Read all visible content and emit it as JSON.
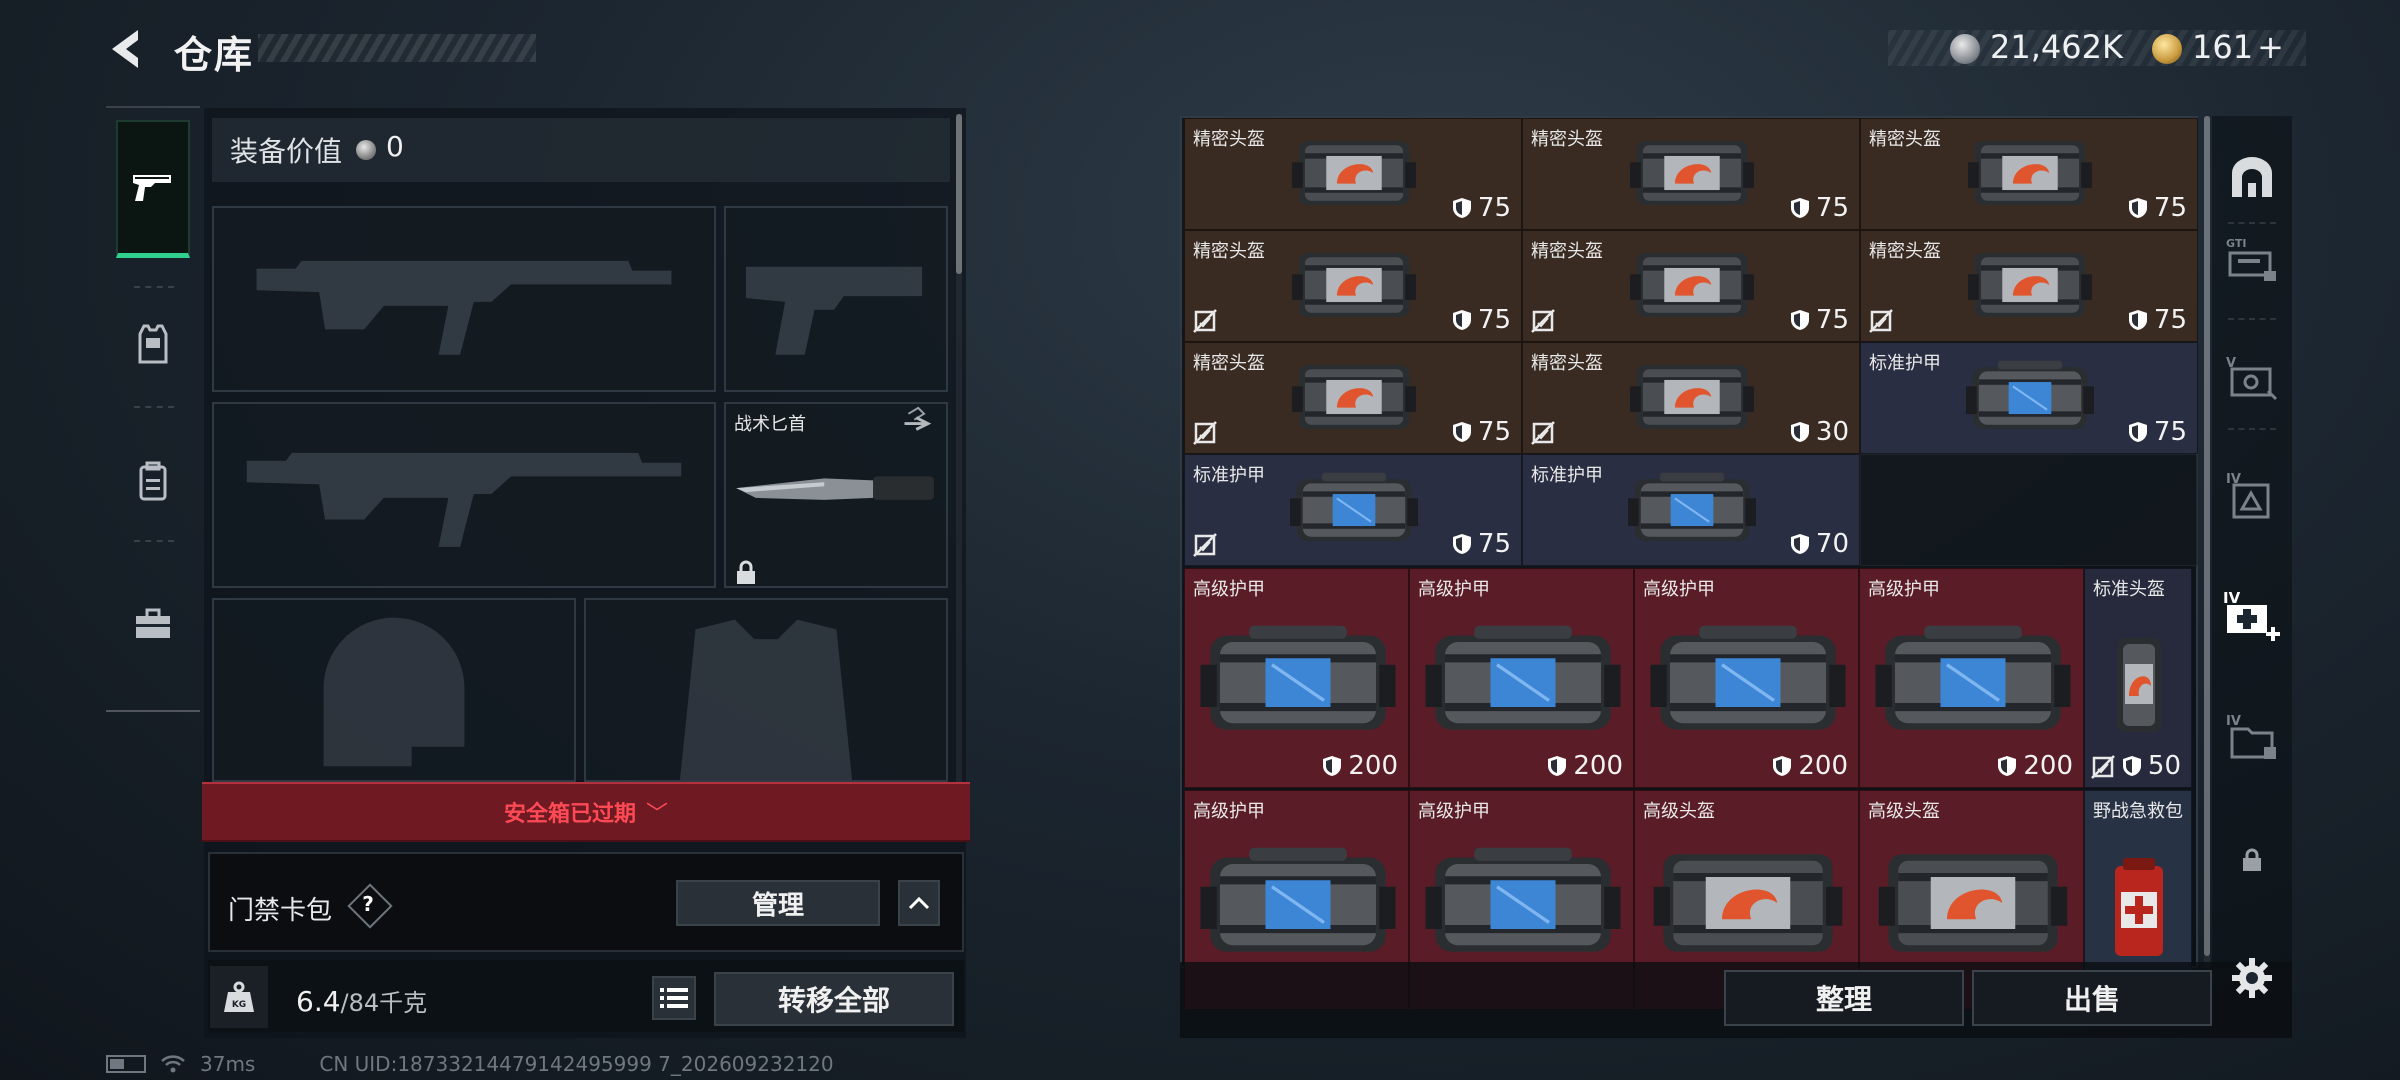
{
  "header": {
    "title": "仓库",
    "currency_a": "21,462K",
    "currency_b": "161",
    "currency_b_add": "+"
  },
  "left_rail": {
    "tabs": [
      {
        "name": "weapons",
        "icon": "pistol-icon",
        "active": true
      },
      {
        "name": "armor",
        "icon": "vest-icon",
        "active": false
      },
      {
        "name": "backpack",
        "icon": "backpack-icon",
        "active": false
      },
      {
        "name": "tools",
        "icon": "toolbox-icon",
        "active": false
      }
    ]
  },
  "loadout": {
    "equip_value_label": "装备价值",
    "equip_value": "0",
    "melee_slot_label": "战术匕首",
    "safebox_text": "安全箱已过期",
    "keycard_label": "门禁卡包",
    "keycard_help": "?",
    "manage_label": "管理",
    "collapse_icon": "chevron-up-icon",
    "weight_value": "6.4",
    "weight_capacity": "/84千克",
    "transfer_all_label": "转移全部"
  },
  "storage": {
    "items": [
      {
        "name": "精密头盔",
        "value": "75",
        "color": "brown",
        "kind": "helmet-red",
        "no_insure": false
      },
      {
        "name": "精密头盔",
        "value": "75",
        "color": "brown",
        "kind": "helmet-red",
        "no_insure": false
      },
      {
        "name": "精密头盔",
        "value": "75",
        "color": "brown",
        "kind": "helmet-red",
        "no_insure": false
      },
      {
        "name": "精密头盔",
        "value": "75",
        "color": "brown",
        "kind": "helmet-red",
        "no_insure": true
      },
      {
        "name": "精密头盔",
        "value": "75",
        "color": "brown",
        "kind": "helmet-red",
        "no_insure": true
      },
      {
        "name": "精密头盔",
        "value": "75",
        "color": "brown",
        "kind": "helmet-red",
        "no_insure": true
      },
      {
        "name": "精密头盔",
        "value": "75",
        "color": "brown",
        "kind": "helmet-red",
        "no_insure": true
      },
      {
        "name": "精密头盔",
        "value": "30",
        "color": "brown",
        "kind": "helmet-red",
        "no_insure": true
      },
      {
        "name": "标准护甲",
        "value": "75",
        "color": "blue",
        "kind": "armor-blue",
        "no_insure": false
      },
      {
        "name": "标准护甲",
        "value": "75",
        "color": "blue",
        "kind": "armor-blue",
        "no_insure": true
      },
      {
        "name": "标准护甲",
        "value": "70",
        "color": "blue",
        "kind": "armor-blue",
        "no_insure": false
      },
      {
        "name": "高级护甲",
        "value": "200",
        "color": "red",
        "kind": "armor-blue",
        "no_insure": false
      },
      {
        "name": "高级护甲",
        "value": "200",
        "color": "red",
        "kind": "armor-blue",
        "no_insure": false
      },
      {
        "name": "高级护甲",
        "value": "200",
        "color": "red",
        "kind": "armor-blue",
        "no_insure": false
      },
      {
        "name": "高级护甲",
        "value": "200",
        "color": "red",
        "kind": "armor-blue",
        "no_insure": false
      },
      {
        "name": "标准头盔",
        "value": "50",
        "color": "navy",
        "kind": "helmet-small",
        "no_insure": true
      },
      {
        "name": "高级护甲",
        "value": "",
        "color": "red",
        "kind": "armor-blue",
        "no_insure": false
      },
      {
        "name": "高级护甲",
        "value": "",
        "color": "red",
        "kind": "armor-blue",
        "no_insure": false
      },
      {
        "name": "高级头盔",
        "value": "",
        "color": "red",
        "kind": "helmet-red",
        "no_insure": false
      },
      {
        "name": "高级头盔",
        "value": "",
        "color": "red",
        "kind": "helmet-red",
        "no_insure": false
      },
      {
        "name": "野战急救包",
        "value": "",
        "color": "steel",
        "kind": "medkit",
        "no_insure": false
      }
    ],
    "sort_label": "整理",
    "sell_label": "出售"
  },
  "right_rail": {
    "tabs": [
      {
        "icon": "safe-arch-icon"
      },
      {
        "icon": "gear-kit-icon",
        "level": "GTI"
      },
      {
        "icon": "case-v-icon",
        "level": "V"
      },
      {
        "icon": "case-iv-icon",
        "level": "IV"
      },
      {
        "icon": "medical-case-icon",
        "level": "IV"
      },
      {
        "icon": "folder-case-icon",
        "level": "IV"
      },
      {
        "icon": "lock-icon"
      },
      {
        "icon": "settings-icon"
      }
    ]
  },
  "status": {
    "ping": "37ms",
    "uid": "CN UID:18733214479142495999 7_202609232120"
  },
  "colors": {
    "accent_green": "#30d08e",
    "warning_red": "#ff4a56",
    "brown_cell": "#3a2b22",
    "blue_cell": "#2a2e43",
    "red_cell": "#5a1c26"
  }
}
